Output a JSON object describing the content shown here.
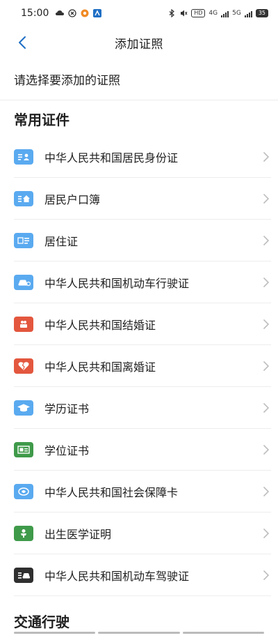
{
  "status_bar": {
    "time": "15:00",
    "hd_label": "HD",
    "net_1": "4G",
    "net_2": "5G",
    "battery": "35"
  },
  "nav": {
    "title": "添加证照",
    "back_icon": "chevron-left-icon"
  },
  "subtitle": "请选择要添加的证照",
  "sections": {
    "common": "常用证件",
    "traffic": "交通行驶"
  },
  "items": [
    {
      "label": "中华人民共和国居民身份证",
      "icon": "id-card-icon",
      "color": "#5aaaf0"
    },
    {
      "label": "居民户口簿",
      "icon": "household-icon",
      "color": "#5aaaf0"
    },
    {
      "label": "居住证",
      "icon": "residence-icon",
      "color": "#5aaaf0"
    },
    {
      "label": "中华人民共和国机动车行驶证",
      "icon": "car-icon",
      "color": "#5aaaf0"
    },
    {
      "label": "中华人民共和国结婚证",
      "icon": "marriage-icon",
      "color": "#e3573e"
    },
    {
      "label": "中华人民共和国离婚证",
      "icon": "broken-heart-icon",
      "color": "#e3573e"
    },
    {
      "label": "学历证书",
      "icon": "graduation-cap-icon",
      "color": "#5aaaf0"
    },
    {
      "label": "学位证书",
      "icon": "degree-icon",
      "color": "#3f9a4a"
    },
    {
      "label": "中华人民共和国社会保障卡",
      "icon": "social-card-icon",
      "color": "#5aaaf0"
    },
    {
      "label": "出生医学证明",
      "icon": "baby-icon",
      "color": "#3f9a4a"
    },
    {
      "label": "中华人民共和国机动车驾驶证",
      "icon": "driver-license-icon",
      "color": "#2f2f2f"
    }
  ],
  "colors": {
    "accent": "#1f6fc5",
    "chevron": "#bdbdbd"
  }
}
